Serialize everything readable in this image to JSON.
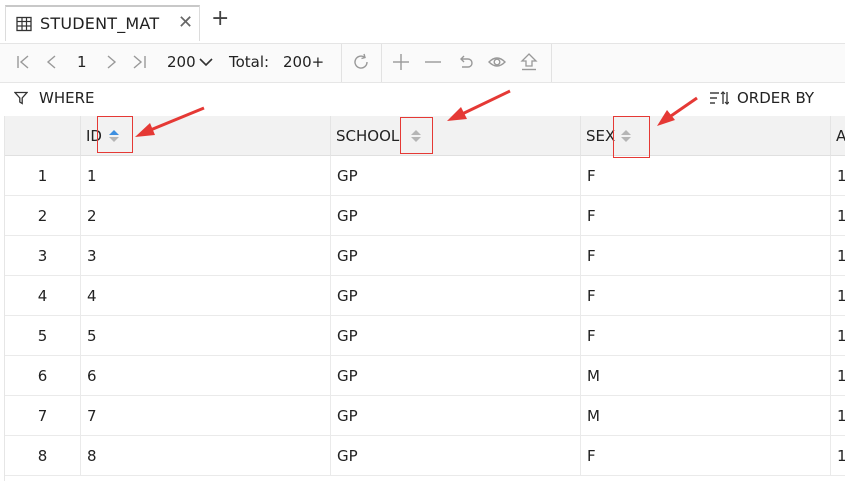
{
  "tab": {
    "title": "STUDENT_MAT",
    "close_glyph": "✕",
    "add_glyph": "+"
  },
  "toolbar": {
    "page": "1",
    "page_size": "200",
    "total_label": "Total:",
    "total_value": "200+"
  },
  "filter": {
    "where_label": "WHERE",
    "order_label": "ORDER BY"
  },
  "columns": [
    {
      "label": "ID",
      "sort": "active"
    },
    {
      "label": "SCHOOL",
      "sort": "none"
    },
    {
      "label": "SEX",
      "sort": "none"
    },
    {
      "label": "A",
      "sort": "none"
    }
  ],
  "rows": [
    {
      "num": "1",
      "id": "1",
      "school": "GP",
      "sex": "F",
      "next": "1"
    },
    {
      "num": "2",
      "id": "2",
      "school": "GP",
      "sex": "F",
      "next": "1"
    },
    {
      "num": "3",
      "id": "3",
      "school": "GP",
      "sex": "F",
      "next": "1"
    },
    {
      "num": "4",
      "id": "4",
      "school": "GP",
      "sex": "F",
      "next": "1"
    },
    {
      "num": "5",
      "id": "5",
      "school": "GP",
      "sex": "F",
      "next": "1"
    },
    {
      "num": "6",
      "id": "6",
      "school": "GP",
      "sex": "M",
      "next": "1"
    },
    {
      "num": "7",
      "id": "7",
      "school": "GP",
      "sex": "M",
      "next": "1"
    },
    {
      "num": "8",
      "id": "8",
      "school": "GP",
      "sex": "F",
      "next": "1"
    }
  ],
  "colors": {
    "annotation": "#e53935",
    "sort_active": "#3d8fe0",
    "sort_inactive": "#b5b5b5"
  }
}
